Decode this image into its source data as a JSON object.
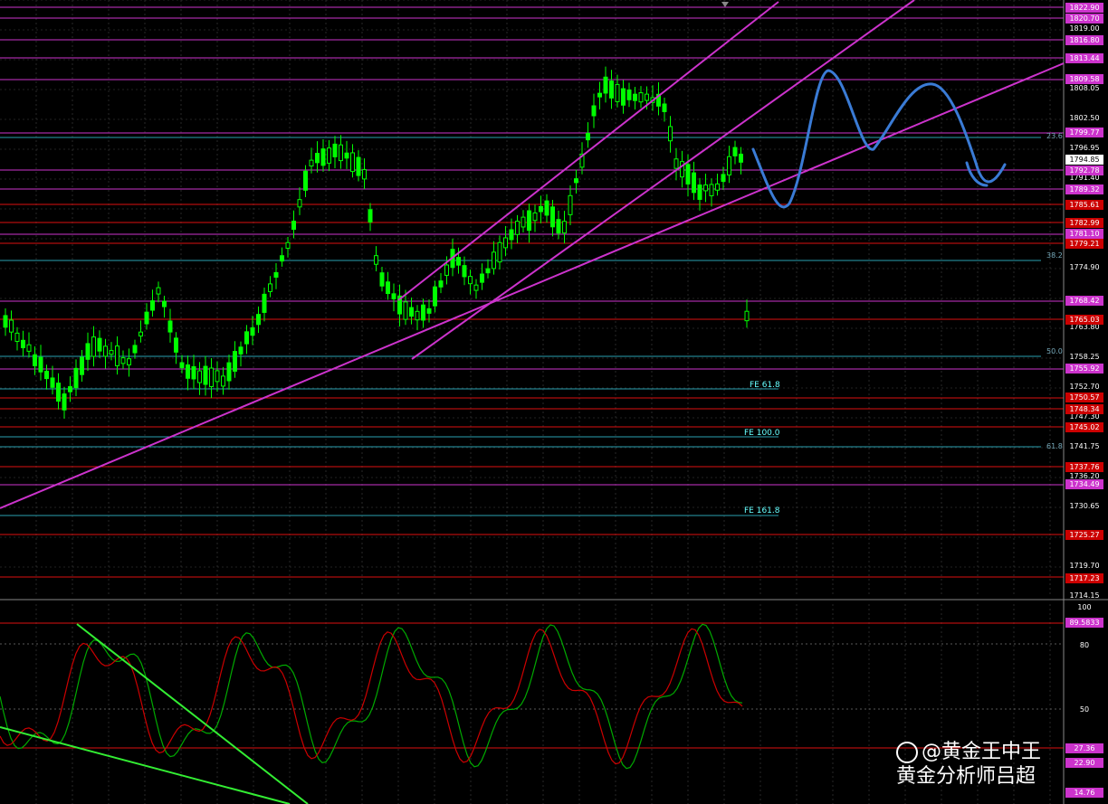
{
  "main_panel": {
    "price_ticks": [
      "1819.00",
      "1808.05",
      "1802.50",
      "1796.95",
      "1791.40",
      "1774.90",
      "1763.80",
      "1758.25",
      "1752.70",
      "1747.30",
      "1741.75",
      "1736.20",
      "1730.65",
      "1719.70",
      "1714.15"
    ],
    "level_labels": [
      {
        "text": "1822.90",
        "color": "#cc33cc"
      },
      {
        "text": "1820.70",
        "color": "#cc33cc"
      },
      {
        "text": "1816.80",
        "color": "#cc33cc"
      },
      {
        "text": "1813.44",
        "color": "#cc33cc"
      },
      {
        "text": "1809.58",
        "color": "#cc33cc"
      },
      {
        "text": "1799.77",
        "color": "#cc33cc"
      },
      {
        "text": "1794.85",
        "color": "#ffffff"
      },
      {
        "text": "1792.78",
        "color": "#cc33cc"
      },
      {
        "text": "1789.32",
        "color": "#cc33cc"
      },
      {
        "text": "1785.61",
        "color": "#cc0000"
      },
      {
        "text": "1782.99",
        "color": "#cc0000"
      },
      {
        "text": "1781.10",
        "color": "#cc33cc"
      },
      {
        "text": "1779.21",
        "color": "#cc0000"
      },
      {
        "text": "1768.42",
        "color": "#cc33cc"
      },
      {
        "text": "1765.03",
        "color": "#cc0000"
      },
      {
        "text": "1755.92",
        "color": "#cc33cc"
      },
      {
        "text": "1750.57",
        "color": "#cc0000"
      },
      {
        "text": "1748.34",
        "color": "#cc0000"
      },
      {
        "text": "1745.02",
        "color": "#cc0000"
      },
      {
        "text": "1737.76",
        "color": "#cc0000"
      },
      {
        "text": "1734.49",
        "color": "#cc33cc"
      },
      {
        "text": "1725.27",
        "color": "#cc0000"
      },
      {
        "text": "1717.23",
        "color": "#cc0000"
      }
    ],
    "fib_labels": {
      "f236": "23.6",
      "f382": "38.2",
      "f500": "50.0",
      "f618": "61.8"
    },
    "fe_labels": {
      "fe618": "FE 61.8",
      "fe100": "FE 100.0",
      "fe1618": "FE 161.8"
    }
  },
  "oscillator_panel": {
    "ticks": [
      "100",
      "80",
      "50"
    ],
    "level_labels": [
      {
        "text": "89.5833",
        "color": "#cc33cc"
      },
      {
        "text": "27.36",
        "color": "#cc33cc"
      },
      {
        "text": "22.90",
        "color": "#cc33cc"
      },
      {
        "text": "14.76",
        "color": "#cc33cc"
      }
    ]
  },
  "watermark": {
    "line1": "@黄金王中王",
    "line2": "黄金分析师吕超"
  },
  "colors": {
    "candle": "#00ff00",
    "trendline": "#cc33cc",
    "forecast": "#3a7bd5",
    "osc_main": "#00aa00",
    "osc_signal": "#cc0000",
    "osc_trend": "#33ee33"
  },
  "icons": {
    "weibo": "weibo-icon"
  }
}
